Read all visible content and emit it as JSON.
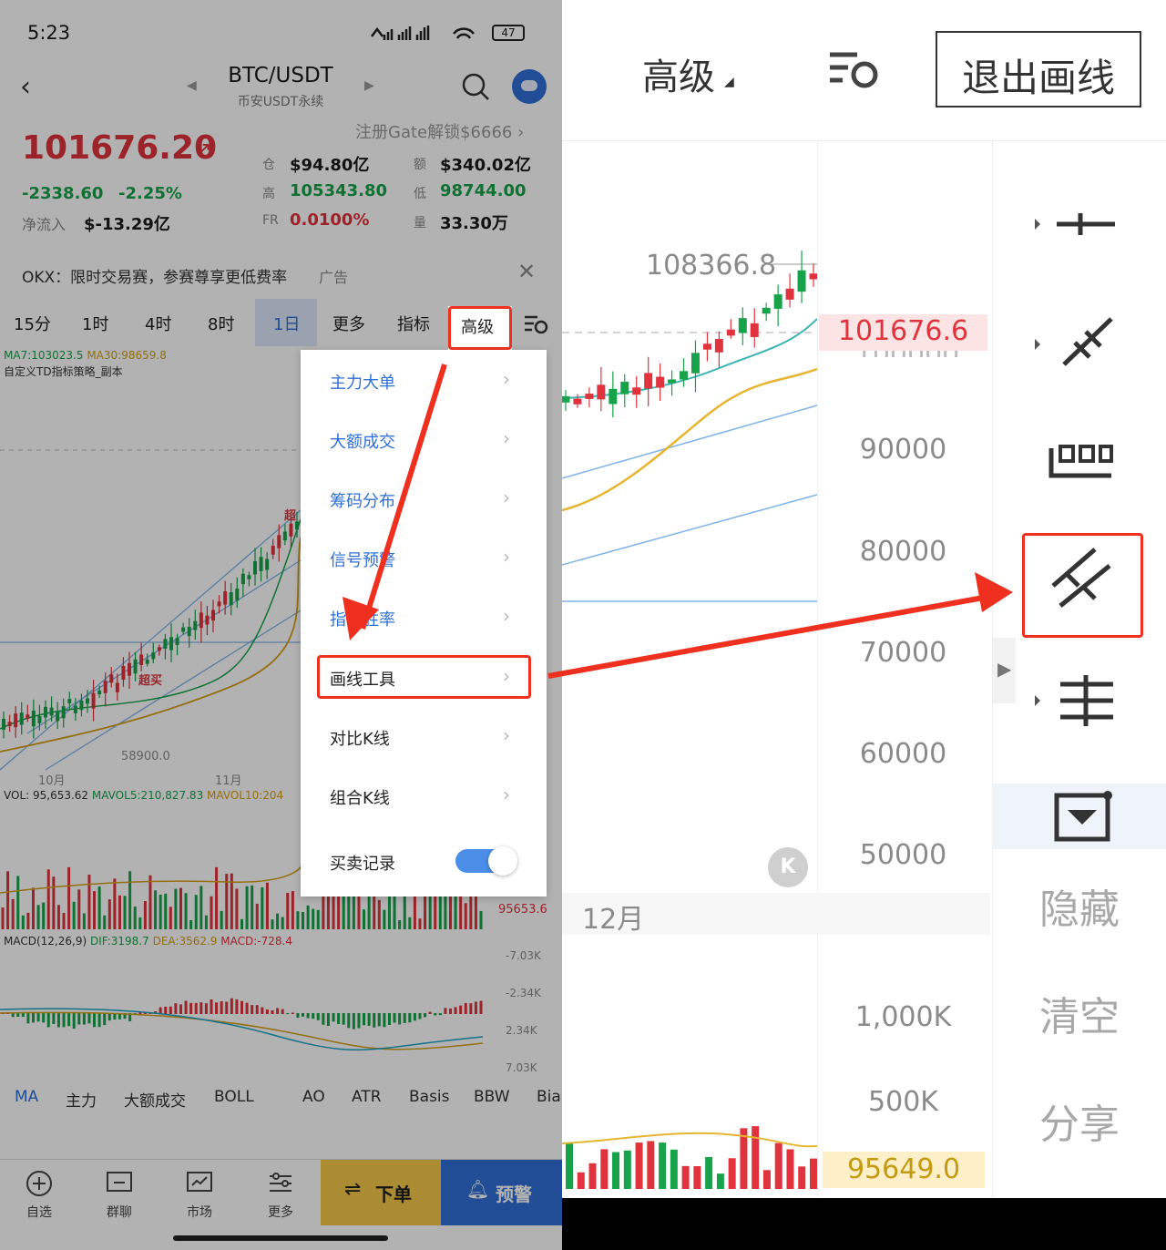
{
  "status": {
    "time": "5:23",
    "battery": "47"
  },
  "header": {
    "symbol": "BTC/USDT",
    "subtitle": "币安USDT永续"
  },
  "promo": {
    "text": "注册Gate解锁$6666 ›"
  },
  "ticker": {
    "price": "101676.20",
    "change": "-2338.60",
    "change_pct": "-2.25%",
    "net_label": "净流入",
    "net_value": "$-13.29亿",
    "oi_label": "仓",
    "oi_value": "$94.80亿",
    "amt_label": "额",
    "amt_value": "$340.02亿",
    "high_label": "高",
    "high_value": "105343.80",
    "low_label": "低",
    "low_value": "98744.00",
    "fr_label": "FR",
    "fr_value": "0.0100%",
    "vol_label": "量",
    "vol_value": "33.30万"
  },
  "ad": {
    "text": "OKX：限时交易赛，参赛尊享更低费率",
    "tag": "广告"
  },
  "timeframes": [
    "15分",
    "1时",
    "4时",
    "8时",
    "1日"
  ],
  "tabs": {
    "more": "更多",
    "indicator": "指标",
    "advanced": "高级"
  },
  "chart_left": {
    "ma_line_ma7": "MA7:103023.5",
    "ma_line_ma30": "MA30:98659.8",
    "strategy": "自定义TD指标策略_副本",
    "marker_super": "超",
    "marker_buy": "超买",
    "low_marker": "58900.0",
    "month1": "10月",
    "month2": "11月",
    "vol_line_a": "VOL: 95,653.62",
    "vol_line_b": "MAVOL5:210,827.83",
    "vol_line_c": "MAVOL10:204",
    "vol_value": "95653.6",
    "macd_line_a": "MACD(12,26,9)",
    "macd_line_b": "DIF:3198.7",
    "macd_line_c": "DEA:3562.9",
    "macd_line_d": "MACD:-728.4",
    "macd_ticks": [
      "-7.03K",
      "-2.34K",
      "2.34K",
      "7.03K"
    ]
  },
  "menu": {
    "items": [
      "主力大单",
      "大额成交",
      "筹码分布",
      "信号预警",
      "指标胜率",
      "画线工具",
      "对比K线",
      "组合K线",
      "买卖记录"
    ],
    "toggle_on": true
  },
  "indicators": [
    "MA",
    "主力",
    "大额成交",
    "BOLL",
    "AO",
    "ATR",
    "Basis",
    "BBW",
    "Bia"
  ],
  "bottom_nav": {
    "items": [
      "自选",
      "群聊",
      "市场",
      "更多"
    ],
    "order": "下单",
    "alert": "预警"
  },
  "right": {
    "advanced": "高级",
    "exit": "退出画线",
    "high_marker": "108366.8",
    "current_price": "101676.6",
    "hidden_tick": "100000",
    "ticks": [
      "90000",
      "80000",
      "70000",
      "60000",
      "50000"
    ],
    "month": "12月",
    "vol_ticks": [
      "1,000K",
      "500K"
    ],
    "vol_value": "95649.0",
    "hide": "隐藏",
    "clear": "清空",
    "share": "分享"
  },
  "colors": {
    "up": "#e0333d",
    "down": "#16a34a",
    "accent": "#2f6fd6",
    "annotation": "#f0301f"
  }
}
